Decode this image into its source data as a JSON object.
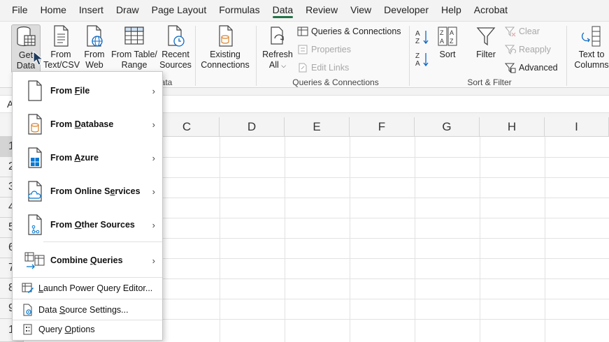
{
  "tabs": [
    "File",
    "Home",
    "Insert",
    "Draw",
    "Page Layout",
    "Formulas",
    "Data",
    "Review",
    "View",
    "Developer",
    "Help",
    "Acrobat"
  ],
  "active_tab": "Data",
  "ribbon": {
    "get_data": {
      "l1": "Get",
      "l2": "Data"
    },
    "from_text": {
      "l1": "From",
      "l2": "Text/CSV"
    },
    "from_web": {
      "l1": "From",
      "l2": "Web"
    },
    "from_table": {
      "l1": "From Table/",
      "l2": "Range"
    },
    "recent": {
      "l1": "Recent",
      "l2": "Sources"
    },
    "existing": {
      "l1": "Existing",
      "l2": "Connections"
    },
    "refresh": {
      "l1": "Refresh",
      "l2": "All"
    },
    "queries_connections": "Queries & Connections",
    "properties": "Properties",
    "edit_links": "Edit Links",
    "sort": "Sort",
    "filter": "Filter",
    "clear": "Clear",
    "reapply": "Reapply",
    "advanced": "Advanced",
    "text_to_columns": {
      "l1": "Text to",
      "l2": "Columns"
    },
    "group_get_data_tail": "ata",
    "group_queries": "Queries & Connections",
    "group_sort": "Sort & Filter"
  },
  "namebox_partial": "A",
  "columns": [
    "C",
    "D",
    "E",
    "F",
    "G",
    "H",
    "I"
  ],
  "rows": [
    "1",
    "2",
    "3",
    "4",
    "5",
    "6",
    "7",
    "8",
    "9",
    "1"
  ],
  "menu": {
    "from_file": {
      "pre": "From ",
      "u": "F",
      "post": "ile"
    },
    "from_database": {
      "pre": "From ",
      "u": "D",
      "post": "atabase"
    },
    "from_azure": {
      "pre": "From ",
      "u": "A",
      "post": "zure"
    },
    "from_online": {
      "pre": "From Online S",
      "u": "e",
      "post": "rvices"
    },
    "from_other": {
      "pre": "From ",
      "u": "O",
      "post": "ther Sources"
    },
    "combine": {
      "pre": "Combine ",
      "u": "Q",
      "post": "ueries"
    },
    "launch": {
      "pre": "",
      "u": "L",
      "post": "aunch Power Query Editor..."
    },
    "data_source": {
      "pre": "Data ",
      "u": "S",
      "post": "ource Settings..."
    },
    "query_options": {
      "pre": "Query ",
      "u": "O",
      "post": "ptions"
    }
  },
  "colors": {
    "accent": "#217346",
    "azure": "#0078d4",
    "db": "#d9822b"
  }
}
